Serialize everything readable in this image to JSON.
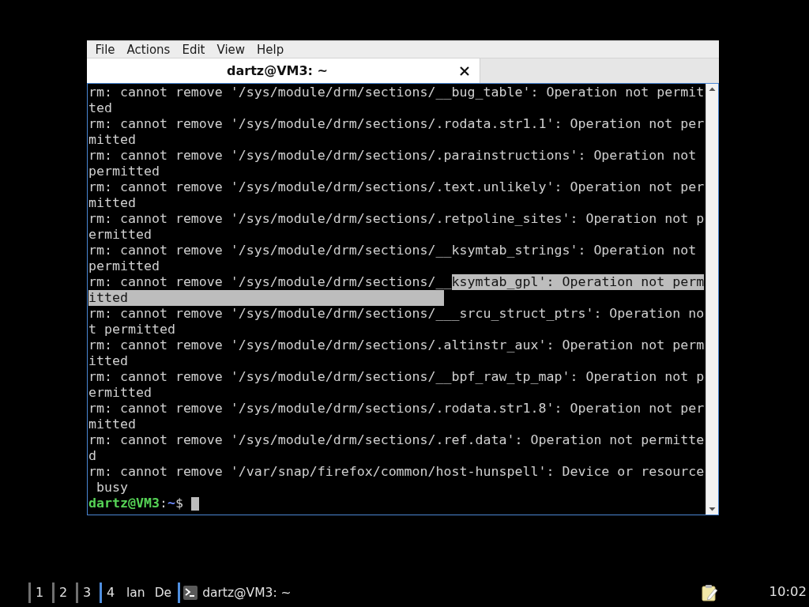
{
  "menu_bar": {
    "items": [
      "File",
      "Actions",
      "Edit",
      "View",
      "Help"
    ]
  },
  "tabs": [
    {
      "label": "dartz@VM3: ~",
      "selected": true
    }
  ],
  "terminal": {
    "rows": [
      {
        "segments": [
          {
            "text": "rm: cannot remove '/sys/module/drm/sections/__bug_table': Operation not permit",
            "selected": false
          }
        ]
      },
      {
        "segments": [
          {
            "text": "ted",
            "selected": false
          }
        ]
      },
      {
        "segments": [
          {
            "text": "rm: cannot remove '/sys/module/drm/sections/.rodata.str1.1': Operation not per",
            "selected": false
          }
        ]
      },
      {
        "segments": [
          {
            "text": "mitted",
            "selected": false
          }
        ]
      },
      {
        "segments": [
          {
            "text": "rm: cannot remove '/sys/module/drm/sections/.parainstructions': Operation not",
            "selected": false
          }
        ]
      },
      {
        "segments": [
          {
            "text": "permitted",
            "selected": false
          }
        ]
      },
      {
        "segments": [
          {
            "text": "rm: cannot remove '/sys/module/drm/sections/.text.unlikely': Operation not per",
            "selected": false
          }
        ]
      },
      {
        "segments": [
          {
            "text": "mitted",
            "selected": false
          }
        ]
      },
      {
        "segments": [
          {
            "text": "rm: cannot remove '/sys/module/drm/sections/.retpoline_sites': Operation not p",
            "selected": false
          }
        ]
      },
      {
        "segments": [
          {
            "text": "ermitted",
            "selected": false
          }
        ]
      },
      {
        "segments": [
          {
            "text": "rm: cannot remove '/sys/module/drm/sections/__ksymtab_strings': Operation not",
            "selected": false
          }
        ]
      },
      {
        "segments": [
          {
            "text": "permitted",
            "selected": false
          }
        ]
      },
      {
        "segments": [
          {
            "text": "rm: cannot remove '/sys/module/drm/sections/__",
            "selected": false
          },
          {
            "text": "ksymtab_gpl': Operation not perm",
            "selected": true
          }
        ]
      },
      {
        "segments": [
          {
            "text": "itted                                        ",
            "selected": true
          }
        ]
      },
      {
        "segments": [
          {
            "text": "rm: cannot remove '/sys/module/drm/sections/___srcu_struct_ptrs': Operation no",
            "selected": false
          }
        ]
      },
      {
        "segments": [
          {
            "text": "t permitted",
            "selected": false
          }
        ]
      },
      {
        "segments": [
          {
            "text": "rm: cannot remove '/sys/module/drm/sections/.altinstr_aux': Operation not perm",
            "selected": false
          }
        ]
      },
      {
        "segments": [
          {
            "text": "itted",
            "selected": false
          }
        ]
      },
      {
        "segments": [
          {
            "text": "rm: cannot remove '/sys/module/drm/sections/__bpf_raw_tp_map': Operation not p",
            "selected": false
          }
        ]
      },
      {
        "segments": [
          {
            "text": "ermitted",
            "selected": false
          }
        ]
      },
      {
        "segments": [
          {
            "text": "rm: cannot remove '/sys/module/drm/sections/.rodata.str1.8': Operation not per",
            "selected": false
          }
        ]
      },
      {
        "segments": [
          {
            "text": "mitted",
            "selected": false
          }
        ]
      },
      {
        "segments": [
          {
            "text": "rm: cannot remove '/sys/module/drm/sections/.ref.data': Operation not permitte",
            "selected": false
          }
        ]
      },
      {
        "segments": [
          {
            "text": "d",
            "selected": false
          }
        ]
      },
      {
        "segments": [
          {
            "text": "rm: cannot remove '/var/snap/firefox/common/host-hunspell': Device or resource",
            "selected": false
          }
        ]
      },
      {
        "segments": [
          {
            "text": " busy",
            "selected": false
          }
        ]
      }
    ],
    "prompt": {
      "user_host": "dartz@VM3",
      "separator": ":",
      "path": "~",
      "symbol": "$"
    }
  },
  "taskbar": {
    "workspaces": [
      {
        "label": "1",
        "selected": false
      },
      {
        "label": "2",
        "selected": false
      },
      {
        "label": "3",
        "selected": false
      },
      {
        "label": "4",
        "selected": true
      }
    ],
    "tasks": [
      {
        "label": "lan",
        "kind": "plain",
        "selected": false
      },
      {
        "label": "De",
        "kind": "plain",
        "selected": false
      },
      {
        "label": "dartz@VM3: ~",
        "kind": "terminal",
        "selected": true
      }
    ],
    "clock": "10:02"
  }
}
